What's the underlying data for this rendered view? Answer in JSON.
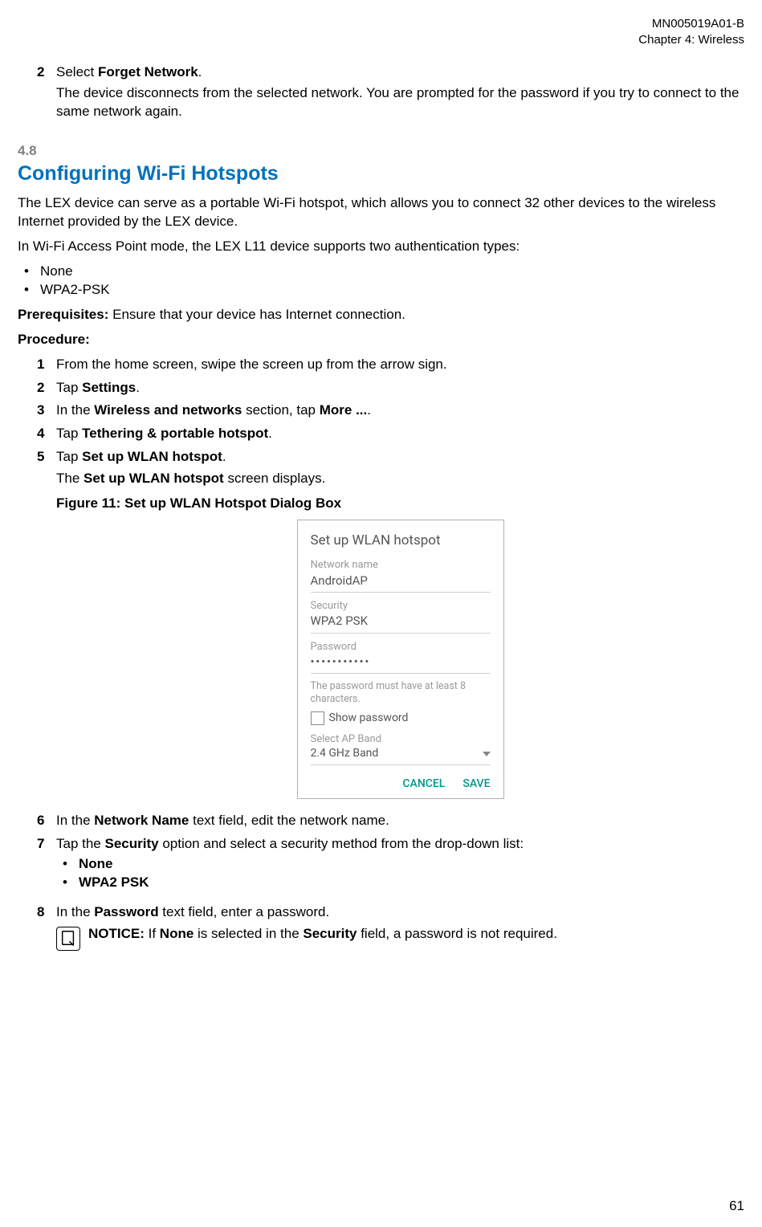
{
  "header": {
    "doc_id": "MN005019A01-B",
    "chapter_line": "Chapter 4:  Wireless"
  },
  "intro_step": {
    "num": "2",
    "text_prefix": "Select ",
    "bold": "Forget Network",
    "text_suffix": ".",
    "result": "The device disconnects from the selected network. You are prompted for the password if you try to connect to the same network again."
  },
  "section": {
    "num": "4.8",
    "title": "Configuring Wi-Fi Hotspots"
  },
  "body": {
    "p1": "The LEX device can serve as a portable Wi-Fi hotspot, which allows you to connect 32 other devices to the wireless Internet provided by the LEX device.",
    "p2": "In Wi-Fi Access Point mode, the LEX L11 device supports two authentication types:",
    "auth_types": [
      "None",
      "WPA2-PSK"
    ],
    "prereq_label": "Prerequisites:",
    "prereq_text": " Ensure that your device has Internet connection.",
    "procedure_label": "Procedure:"
  },
  "steps": {
    "s1": {
      "num": "1",
      "text": "From the home screen, swipe the screen up from the arrow sign."
    },
    "s2": {
      "num": "2",
      "text_prefix": "Tap ",
      "bold": "Settings",
      "text_suffix": "."
    },
    "s3": {
      "num": "3",
      "text_prefix": "In the ",
      "bold1": "Wireless and networks",
      "mid": " section, tap ",
      "bold2": "More ...",
      "text_suffix": "."
    },
    "s4": {
      "num": "4",
      "text_prefix": "Tap ",
      "bold": "Tethering & portable hotspot",
      "text_suffix": "."
    },
    "s5": {
      "num": "5",
      "text_prefix": "Tap ",
      "bold": "Set up WLAN hotspot",
      "text_suffix": ".",
      "result_prefix": "The ",
      "result_bold": "Set up WLAN hotspot",
      "result_suffix": " screen displays.",
      "figure_caption": "Figure 11: Set up WLAN Hotspot Dialog Box"
    },
    "s6": {
      "num": "6",
      "text_prefix": "In the ",
      "bold": "Network Name",
      "text_suffix": " text field, edit the network name."
    },
    "s7": {
      "num": "7",
      "text_prefix": "Tap the ",
      "bold": "Security",
      "text_suffix": " option and select a security method from the drop-down list:",
      "options": [
        "None",
        "WPA2 PSK"
      ]
    },
    "s8": {
      "num": "8",
      "text_prefix": "In the ",
      "bold": "Password",
      "text_suffix": " text field, enter a password."
    }
  },
  "notice": {
    "label": "NOTICE:",
    "prefix": " If ",
    "bold1": "None",
    "mid": " is selected in the ",
    "bold2": "Security",
    "suffix": " field, a password is not required."
  },
  "dialog": {
    "title": "Set up WLAN hotspot",
    "network_name_label": "Network name",
    "network_name_value": "AndroidAP",
    "security_label": "Security",
    "security_value": "WPA2 PSK",
    "password_label": "Password",
    "password_value": "• • • • • • • • • • •",
    "password_hint": "The password must have at least 8 characters.",
    "show_password": "Show password",
    "ap_band_label": "Select AP Band",
    "ap_band_value": "2.4 GHz Band",
    "cancel": "CANCEL",
    "save": "SAVE"
  },
  "page_number": "61"
}
